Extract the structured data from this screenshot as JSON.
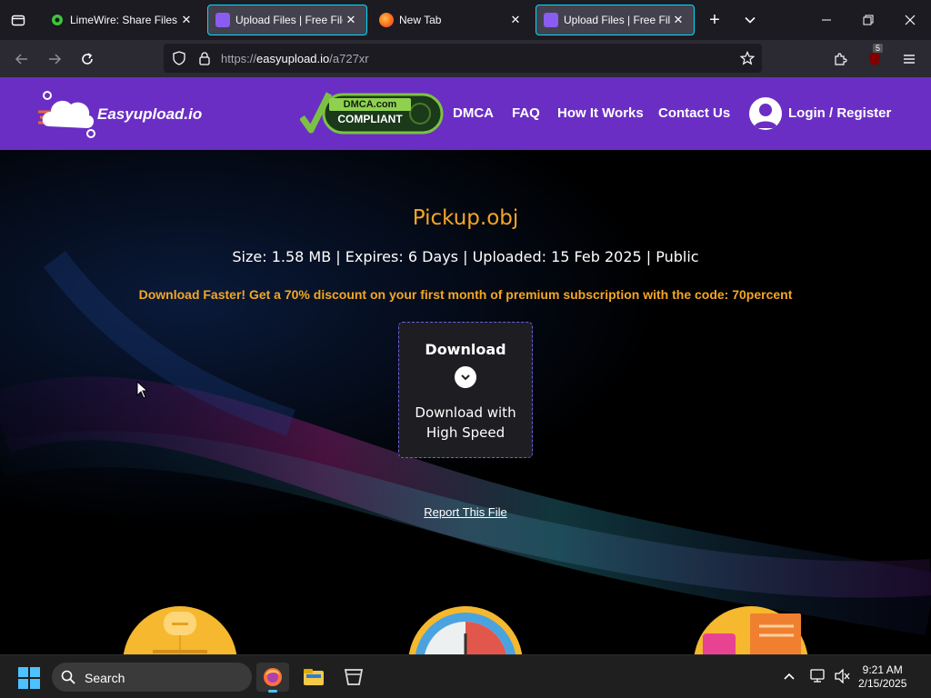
{
  "browser": {
    "tabs": [
      {
        "title": "LimeWire: Share Files -",
        "active": false,
        "favicon": "limewire-icon"
      },
      {
        "title": "Upload Files | Free File",
        "active": true,
        "favicon": "easyupload-icon"
      },
      {
        "title": "New Tab",
        "active": false,
        "favicon": "firefox-icon"
      },
      {
        "title": "Upload Files | Free File",
        "active": true,
        "favicon": "easyupload-icon"
      }
    ],
    "url_prefix": "https://",
    "url_domain": "easyupload.io",
    "url_path": "/a727xr",
    "extension_badge": "5"
  },
  "site": {
    "logo_text": "Easyupload.io",
    "dmca_line1": "DMCA.com",
    "dmca_line2": "COMPLIANT",
    "nav": [
      "DMCA",
      "FAQ",
      "How It Works",
      "Contact Us"
    ],
    "login": "Login / Register",
    "brand_color": "#6a2ec4"
  },
  "file": {
    "name": "Pickup.obj",
    "meta": "Size: 1.58 MB | Expires: 6 Days | Uploaded: 15 Feb 2025 | Public",
    "promo": "Download Faster! Get a 70% discount on your first month of premium subscription with the code: 70percent",
    "download_label": "Download",
    "download_sub": "Download with High Speed",
    "report": "Report This File"
  },
  "taskbar": {
    "search": "Search",
    "time": "9:21 AM",
    "date": "2/15/2025"
  }
}
